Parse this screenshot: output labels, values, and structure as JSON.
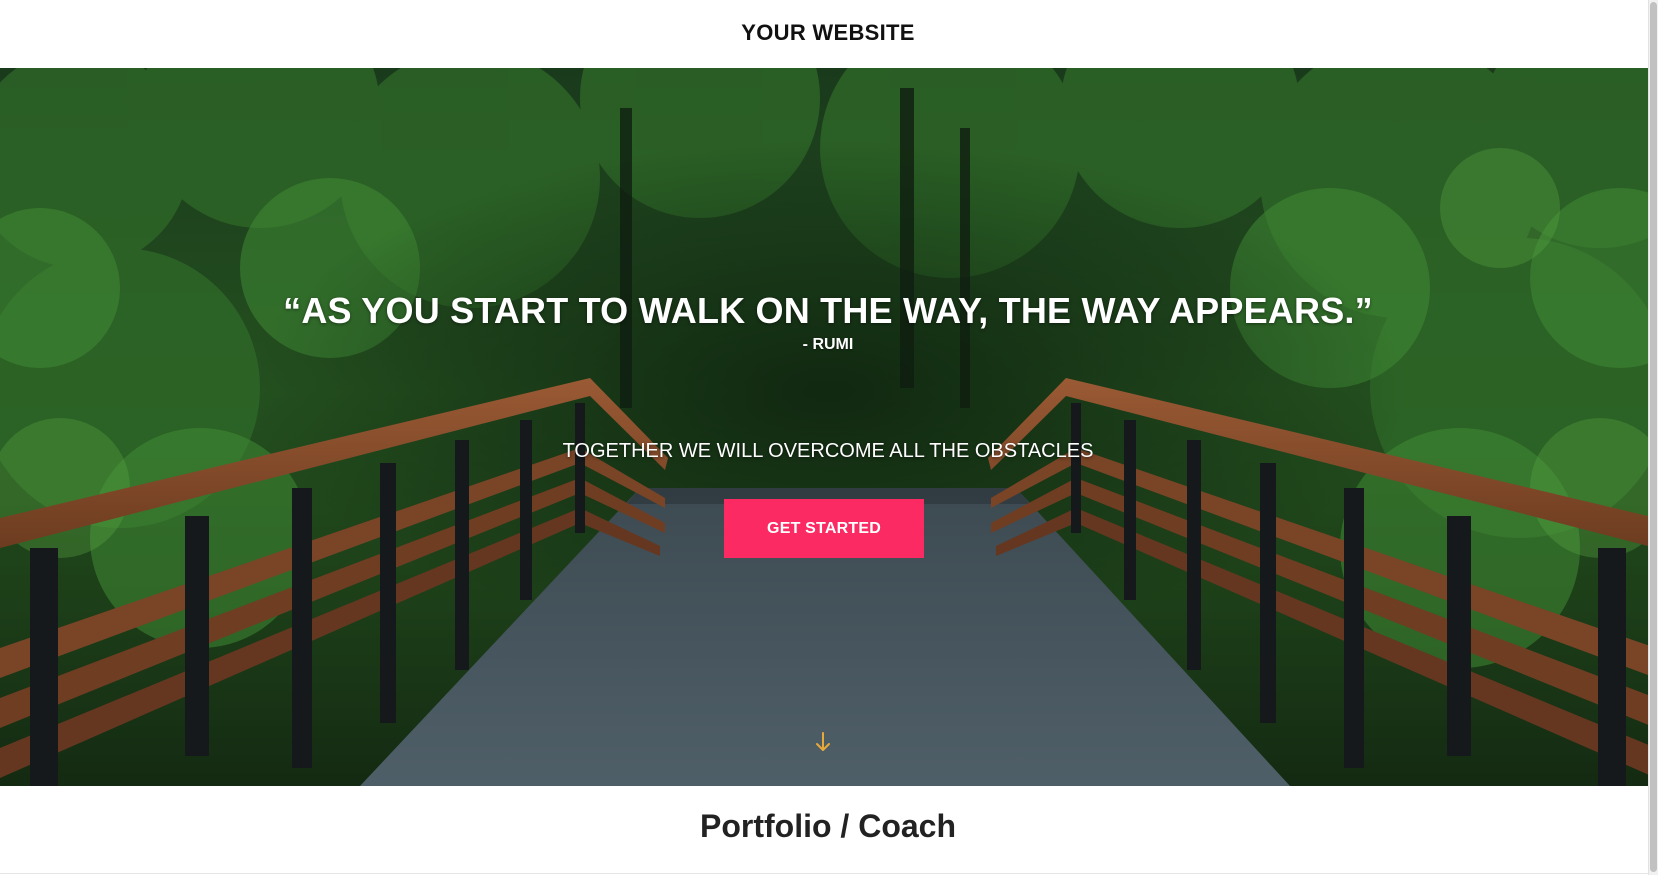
{
  "header": {
    "site_title": "YOUR WEBSITE"
  },
  "hero": {
    "quote": "“AS YOU START TO WALK ON THE WAY, THE WAY APPEARS.”",
    "author": "- RUMI",
    "tagline": "TOGETHER WE WILL OVERCOME ALL THE OBSTACLES",
    "cta_label": "GET STARTED",
    "scroll_icon": "arrow-down-icon",
    "background_image": "wooden footbridge into forest"
  },
  "section": {
    "title": "Portfolio / Coach"
  },
  "colors": {
    "accent": "#fb2a62",
    "arrow": "#e8a93a",
    "text_dark": "#111111",
    "background": "#ffffff"
  }
}
